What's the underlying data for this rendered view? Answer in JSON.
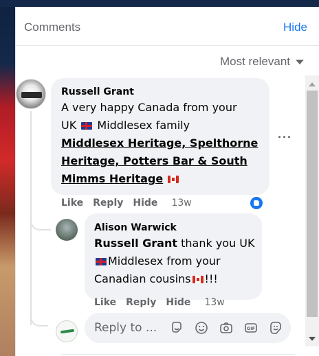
{
  "header": {
    "title": "Comments",
    "hide_label": "Hide"
  },
  "sort": {
    "label": "Most relevant"
  },
  "comment": {
    "author": "Russell Grant",
    "line1": "A very happy Canada from your",
    "line2": "UK",
    "line2b": "Middlesex family",
    "link_line1": "Middlesex Heritage, Spelthorne",
    "link_line2": "Heritage, Potters Bar & South",
    "link_line3": "Mimms Heritage",
    "actions": {
      "like": "Like",
      "reply": "Reply",
      "hide": "Hide",
      "time": "13w"
    }
  },
  "reply": {
    "author": "Alison Warwick",
    "mention": "Russell Grant",
    "line1_rest": " thank you UK",
    "line2": "Middlesex from your",
    "line3": "Canadian cousins",
    "line3_end": "!!!",
    "actions": {
      "like": "Like",
      "reply": "Reply",
      "hide": "Hide",
      "time": "13w"
    }
  },
  "reply_box": {
    "placeholder": "Reply to ..."
  },
  "icons": [
    "sticker-icon",
    "emoji-icon",
    "camera-icon",
    "gif-icon",
    "avatar-sticker-icon"
  ],
  "colors": {
    "accent": "#1877f2",
    "bubble": "#f0f2f5",
    "muted": "#65676b"
  }
}
